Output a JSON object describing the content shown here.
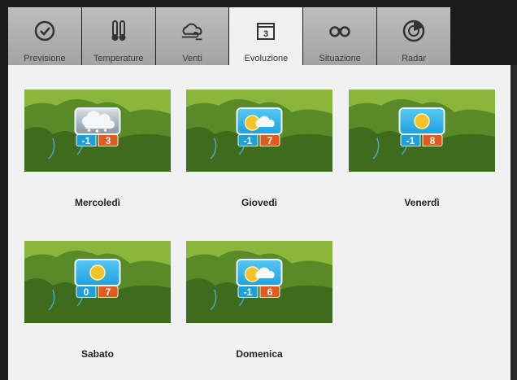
{
  "tabs": [
    {
      "label": "Previsione",
      "icon": "clock-icon",
      "active": false
    },
    {
      "label": "Temperature",
      "icon": "thermometer-icon",
      "active": false
    },
    {
      "label": "Venti",
      "icon": "wind-icon",
      "active": false
    },
    {
      "label": "Evoluzione",
      "icon": "calendar-icon",
      "active": true,
      "icon_text": "3"
    },
    {
      "label": "Situazione",
      "icon": "binoculars-icon",
      "active": false
    },
    {
      "label": "Radar",
      "icon": "radar-icon",
      "active": false
    }
  ],
  "days": [
    {
      "name": "Mercoledì",
      "min": "-1",
      "max": "3",
      "weather": "snow-cloud-icon"
    },
    {
      "name": "Giovedì",
      "min": "-1",
      "max": "7",
      "weather": "sun-cloud-icon"
    },
    {
      "name": "Venerdì",
      "min": "-1",
      "max": "8",
      "weather": "sun-icon"
    },
    {
      "name": "Sabato",
      "min": "0",
      "max": "7",
      "weather": "sun-icon"
    },
    {
      "name": "Domenica",
      "min": "-1",
      "max": "6",
      "weather": "sun-cloud-icon"
    }
  ],
  "colors": {
    "min_temp": "#1f9ed8",
    "max_temp": "#e15a1f",
    "sky": "#29a9e1",
    "map_green": "#4f7c24"
  }
}
